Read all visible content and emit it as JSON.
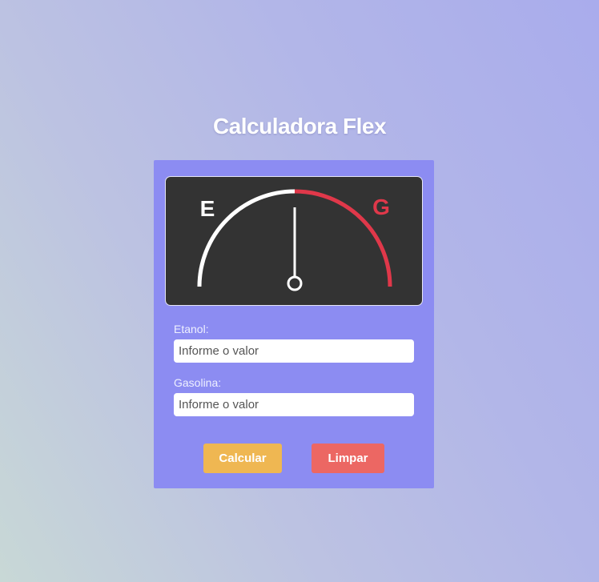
{
  "app": {
    "title": "Calculadora Flex"
  },
  "gauge": {
    "left_label": "E",
    "right_label": "G",
    "needle_icon": "fuel-gauge-needle",
    "colors": {
      "ethanol_arc": "#ffffff",
      "gasoline_arc": "#e0384a",
      "panel": "#333333"
    }
  },
  "form": {
    "ethanol": {
      "label": "Etanol:",
      "value": "",
      "placeholder": "Informe o valor"
    },
    "gasoline": {
      "label": "Gasolina:",
      "value": "",
      "placeholder": "Informe o valor"
    }
  },
  "buttons": {
    "calculate_label": "Calcular",
    "clear_label": "Limpar",
    "calculate_color": "#efb752",
    "clear_color": "#ec6763"
  }
}
